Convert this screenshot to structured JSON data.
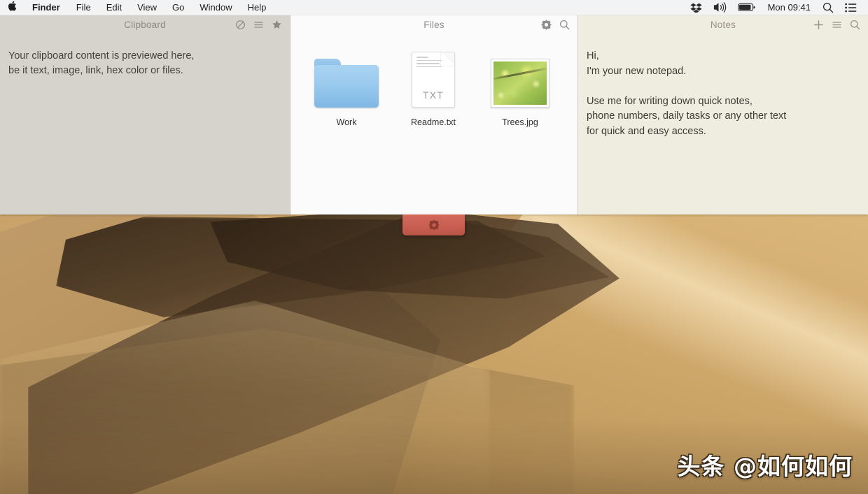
{
  "menubar": {
    "apple_glyph": "",
    "items": [
      {
        "label": "Finder",
        "bold": true,
        "name": "menu-finder"
      },
      {
        "label": "File",
        "bold": false,
        "name": "menu-file"
      },
      {
        "label": "Edit",
        "bold": false,
        "name": "menu-edit"
      },
      {
        "label": "View",
        "bold": false,
        "name": "menu-view"
      },
      {
        "label": "Go",
        "bold": false,
        "name": "menu-go"
      },
      {
        "label": "Window",
        "bold": false,
        "name": "menu-window"
      },
      {
        "label": "Help",
        "bold": false,
        "name": "menu-help"
      }
    ],
    "status_icons": [
      "dropbox-icon",
      "volume-icon",
      "battery-icon"
    ],
    "clock": "Mon 09:41",
    "right_icons": [
      "spotlight-search-icon",
      "control-center-icon"
    ]
  },
  "clipboard_panel": {
    "title": "Clipboard",
    "body_text": "Your clipboard content is previewed here,\nbe it text, image, link, hex color or files.",
    "actions": [
      "clear-icon",
      "list-icon",
      "favorite-star-icon"
    ],
    "bg_color": "#d6d3cc"
  },
  "files_panel": {
    "title": "Files",
    "actions": [
      "gear-icon",
      "search-icon"
    ],
    "bg_color": "#fbfbfb",
    "items": [
      {
        "label": "Work",
        "kind": "folder",
        "name": "file-item-work"
      },
      {
        "label": "Readme.txt",
        "kind": "document",
        "ext": "TXT",
        "name": "file-item-readme"
      },
      {
        "label": "Trees.jpg",
        "kind": "image",
        "name": "file-item-trees"
      }
    ]
  },
  "notes_panel": {
    "title": "Notes",
    "body_text": "Hi,\nI'm your new notepad.\n\nUse me for writing down quick notes,\nphone numbers, daily tasks or any other text\nfor quick and easy access.",
    "actions": [
      "plus-icon",
      "list-icon",
      "search-icon"
    ],
    "bg_color": "#efece0"
  },
  "handle": {
    "icon": "gear-icon",
    "color": "#c85f52"
  },
  "desktop": {
    "wallpaper_name": "mojave-desert-dunes",
    "watermark": "头条 @如何如何"
  }
}
